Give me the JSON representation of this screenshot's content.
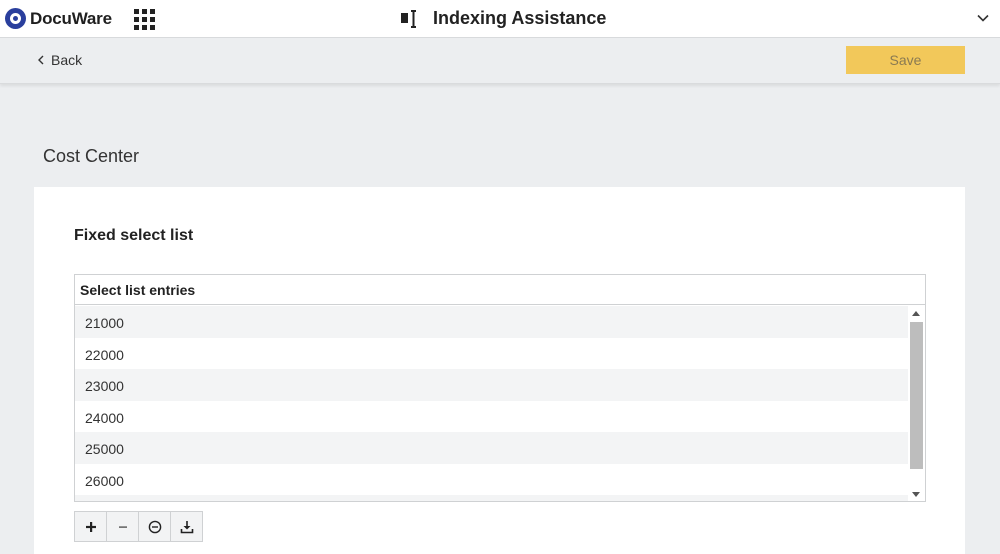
{
  "app": {
    "brand": "DocuWare",
    "title": "Indexing Assistance",
    "brand_color": "#2a3f9d"
  },
  "actions": {
    "back_label": "Back",
    "save_label": "Save",
    "save_color": "#f2c85a"
  },
  "section": {
    "title": "Cost Center"
  },
  "card": {
    "title": "Fixed select list",
    "list_header": "Select list entries",
    "entries": [
      "21000",
      "22000",
      "23000",
      "24000",
      "25000",
      "26000",
      ""
    ]
  },
  "toolbar": {
    "buttons": [
      "plus-icon",
      "minus-icon",
      "remove-circle-icon",
      "download-icon"
    ]
  },
  "icons": {
    "apps": "apps-grid-icon",
    "title": "text-cursor-icon",
    "collapse": "chevron-down-icon",
    "back": "chevron-left-icon"
  }
}
